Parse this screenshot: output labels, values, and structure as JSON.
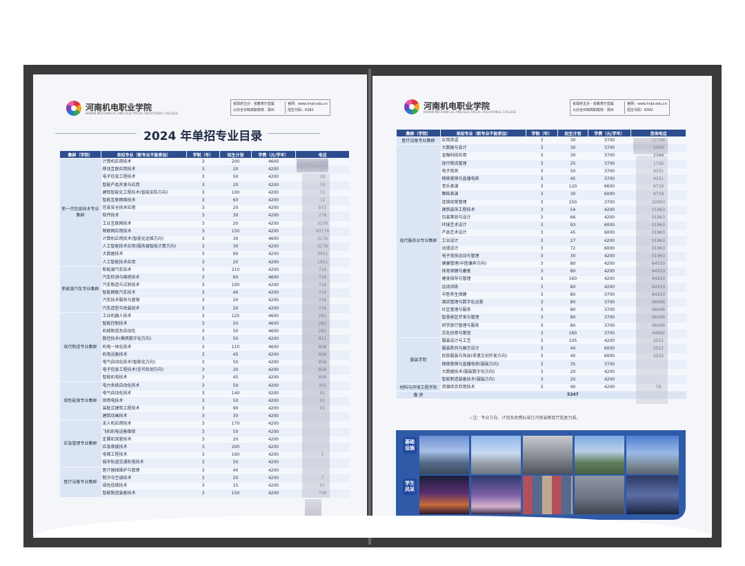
{
  "left_page": {
    "school_name": "河南机电职业学院",
    "school_en": "HENAN MECHANICAL AND ELECTRICAL VOCATIONAL COLLEGE",
    "info": {
      "line1_a": "省政府主办 · 省教育厅直属",
      "line1_b": "官网：www.hnjd.edu.cn",
      "line2_a": "公办全日制高职院校 · 郑州",
      "line2_b": "招生代码：6382"
    },
    "title": "2024 年单招专业目录",
    "headers": [
      "集群（学院）",
      "单招专业（新专业不能参加）",
      "学制（年）",
      "招生计划",
      "学费（元/学年）",
      "电话"
    ],
    "groups": [
      {
        "name": "新一代信息技术专业集群",
        "rows": [
          [
            "计算机应用技术",
            "3",
            "200",
            "4600",
            "6839"
          ],
          [
            "移动互联应用技术",
            "3",
            "20",
            "4200",
            "39"
          ],
          [
            "电子信息工程技术",
            "3",
            "50",
            "4200",
            "39"
          ],
          [
            "智能产品开发与应用",
            "3",
            "20",
            "4200",
            "39"
          ],
          [
            "建筑智能化工程技术(智能安防方向)",
            "3",
            "100",
            "4200",
            "72"
          ],
          [
            "智能互联网络技术",
            "3",
            "60",
            "4200",
            "72"
          ],
          [
            "信息安全技术应用",
            "3",
            "20",
            "4200",
            "872"
          ],
          [
            "软件技术",
            "3",
            "30",
            "4200",
            "278"
          ],
          [
            "工业互联网技术",
            "3",
            "20",
            "4200",
            "3278"
          ],
          [
            "物联网应用技术",
            "3",
            "150",
            "4200",
            "93176"
          ],
          [
            "计算机应用技术(智能化运维方向)",
            "3",
            "30",
            "4600",
            "3176"
          ],
          [
            "人工智能技术应用(服务器智能计算方向)",
            "3",
            "30",
            "4200",
            "3176"
          ],
          [
            "大数据技术",
            "3",
            "90",
            "4200",
            "3001"
          ],
          [
            "人工智能技术应用",
            "3",
            "20",
            "4200",
            "1001"
          ]
        ]
      },
      {
        "name": "新能源汽车专业集群",
        "rows": [
          [
            "新能源汽车技术",
            "3",
            "210",
            "4200",
            "716"
          ],
          [
            "汽车检测与维修技术",
            "3",
            "60",
            "4600",
            "716"
          ],
          [
            "汽车制造与试验技术",
            "3",
            "100",
            "4200",
            "716"
          ],
          [
            "智能网联汽车技术",
            "3",
            "40",
            "4200",
            "716"
          ],
          [
            "汽车技术服务与营销",
            "3",
            "20",
            "4200",
            "716"
          ],
          [
            "汽车造型与改装技术",
            "3",
            "20",
            "4200",
            "716"
          ]
        ]
      },
      {
        "name": "现代制造专业集群",
        "rows": [
          [
            "工业机器人技术",
            "3",
            "125",
            "4600",
            "281"
          ],
          [
            "智能控制技术",
            "3",
            "50",
            "4600",
            "281"
          ],
          [
            "机械制造及自动化",
            "3",
            "50",
            "4600",
            "281"
          ],
          [
            "数控技术(模具数字化方向)",
            "3",
            "50",
            "4200",
            "811"
          ],
          [
            "机电一体化技术",
            "3",
            "110",
            "4600",
            "858"
          ],
          [
            "机电设备技术",
            "3",
            "45",
            "4200",
            "858"
          ],
          [
            "电气自动化技术(智能化方向)",
            "3",
            "50",
            "4200",
            "858"
          ],
          [
            "电子信息工程技术(信号检测方向)",
            "3",
            "20",
            "4200",
            "858"
          ],
          [
            "智能机电技术",
            "3",
            "45",
            "4200",
            "858"
          ]
        ]
      },
      {
        "name": "绿色能源专业集群",
        "rows": [
          [
            "电力系统自动化技术",
            "3",
            "50",
            "4200",
            "301"
          ],
          [
            "电气自动化技术",
            "3",
            "140",
            "4200",
            "01"
          ],
          [
            "供用电技术",
            "3",
            "50",
            "4200",
            "01"
          ],
          [
            "装配式建筑工程技术",
            "3",
            "90",
            "4200",
            "01"
          ],
          [
            "建筑动画技术",
            "3",
            "30",
            "4200",
            ""
          ]
        ]
      },
      {
        "name": "应急管理专业集群",
        "rows": [
          [
            "无人机应用技术",
            "3",
            "170",
            "4200",
            ""
          ],
          [
            "飞机机电设备维修",
            "3",
            "50",
            "4200",
            ""
          ],
          [
            "定翼机驾驶技术",
            "3",
            "20",
            "4200",
            ""
          ],
          [
            "应急救援技术",
            "3",
            "200",
            "4200",
            ""
          ],
          [
            "电梯工程技术",
            "3",
            "160",
            "4200",
            "1"
          ],
          [
            "城市轨道交通机电技术",
            "3",
            "50",
            "4200",
            ""
          ]
        ]
      },
      {
        "name": "医疗设备专业集群",
        "rows": [
          [
            "医疗器械维护与管理",
            "3",
            "40",
            "4200",
            ""
          ],
          [
            "制冷与空调技术",
            "3",
            "20",
            "4200",
            "7"
          ],
          [
            "绿色低碳技术",
            "3",
            "15",
            "4200",
            "07"
          ],
          [
            "智能制造装备技术",
            "3",
            "150",
            "4200",
            "798"
          ]
        ]
      }
    ]
  },
  "right_page": {
    "school_name": "河南机电职业学院",
    "school_en": "HENAN MECHANICAL AND ELECTRICAL VOCATIONAL COLLEGE",
    "info": {
      "line1_a": "省政府主办 · 省教育厅直属",
      "line1_b": "官网：www.hnjd.edu.cn",
      "line2_a": "公办全日制高职院校 · 郑州",
      "line2_b": "招生代码：6382"
    },
    "headers": [
      "集群（学院）",
      "单招专业（新专业不能参加）",
      "学制（年）",
      "招生计划",
      "学费（元/学年）",
      "咨询电话"
    ],
    "groups": [
      {
        "name": "医疗设备专业集群",
        "rows": [
          [
            "应用英语",
            "3",
            "30",
            "3700",
            "15798"
          ]
        ]
      },
      {
        "name": "现代服务业专业集群",
        "rows": [
          [
            "大数据与会计",
            "3",
            "30",
            "3700",
            "2349"
          ],
          [
            "金融科技应用",
            "3",
            "30",
            "3700",
            "2349"
          ],
          [
            "现代物流管理",
            "3",
            "25",
            "3700",
            "1726"
          ],
          [
            "电子商务",
            "3",
            "50",
            "3700",
            "4331"
          ],
          [
            "网络营销与直播电商",
            "3",
            "45",
            "3700",
            "4331"
          ],
          [
            "音乐表演",
            "3",
            "120",
            "6600",
            "9718"
          ],
          [
            "舞蹈表演",
            "3",
            "30",
            "6000",
            "9718"
          ],
          [
            "连锁经营管理",
            "3",
            "150",
            "3700",
            "32063"
          ],
          [
            "建筑装饰工程技术",
            "3",
            "54",
            "4200",
            "01963"
          ],
          [
            "包装策划与设计",
            "3",
            "66",
            "4200",
            "01963"
          ],
          [
            "环境艺术设计",
            "3",
            "93",
            "6000",
            "01963"
          ],
          [
            "产品艺术设计",
            "3",
            "45",
            "6000",
            "01963"
          ],
          [
            "工业设计",
            "3",
            "27",
            "4200",
            "01963"
          ],
          [
            "动漫设计",
            "3",
            "72",
            "6000",
            "01963"
          ],
          [
            "电子竞技运动与管理",
            "3",
            "30",
            "4200",
            "01963"
          ],
          [
            "健康管理(中医康养方向)",
            "3",
            "80",
            "4200",
            "64333"
          ],
          [
            "体育保健与康复",
            "3",
            "80",
            "4200",
            "64333"
          ],
          [
            "健身指导与管理",
            "3",
            "160",
            "4200",
            "64333"
          ],
          [
            "运动训练",
            "3",
            "80",
            "4200",
            "64333"
          ],
          [
            "中医养生保健",
            "3",
            "80",
            "3700",
            "64333"
          ],
          [
            "酒店管理与数字化运营",
            "3",
            "80",
            "3700",
            "06006"
          ],
          [
            "社区管理与服务",
            "3",
            "80",
            "3700",
            "06006"
          ],
          [
            "智慧景区开发与管理",
            "3",
            "80",
            "3700",
            "06006"
          ],
          [
            "研学旅行管理与服务",
            "3",
            "80",
            "3700",
            "06006"
          ],
          [
            "文化创意与策划",
            "3",
            "160",
            "3700",
            "44092"
          ]
        ]
      },
      {
        "name": "服装学院",
        "rows": [
          [
            "服装设计与工艺",
            "3",
            "105",
            "4200",
            "2512"
          ],
          [
            "服装陈列与展示设计",
            "3",
            "40",
            "6000",
            "2512"
          ],
          [
            "民族服装与饰品(非遗文创开发方向)",
            "3",
            "40",
            "6000",
            "2552"
          ],
          [
            "网络营销与直播电商(服装方向)",
            "3",
            "35",
            "3700",
            ""
          ],
          [
            "大数据技术(服装数字化方向)",
            "3",
            "20",
            "4200",
            ""
          ],
          [
            "智能制造装备技术(服装方向)",
            "3",
            "20",
            "4200",
            ""
          ]
        ]
      },
      {
        "name": "材料与环境工程学院",
        "rows": [
          [
            "资源综合利用技术",
            "3",
            "40",
            "4200",
            "78"
          ]
        ]
      }
    ],
    "total_label": "合 计",
    "total_value": "5247",
    "note": "☆注：专业方向、计划及收费标准已河南省教育厅批复为准。",
    "tags": {
      "facilities": "基础设施",
      "students": "学生风采"
    }
  }
}
